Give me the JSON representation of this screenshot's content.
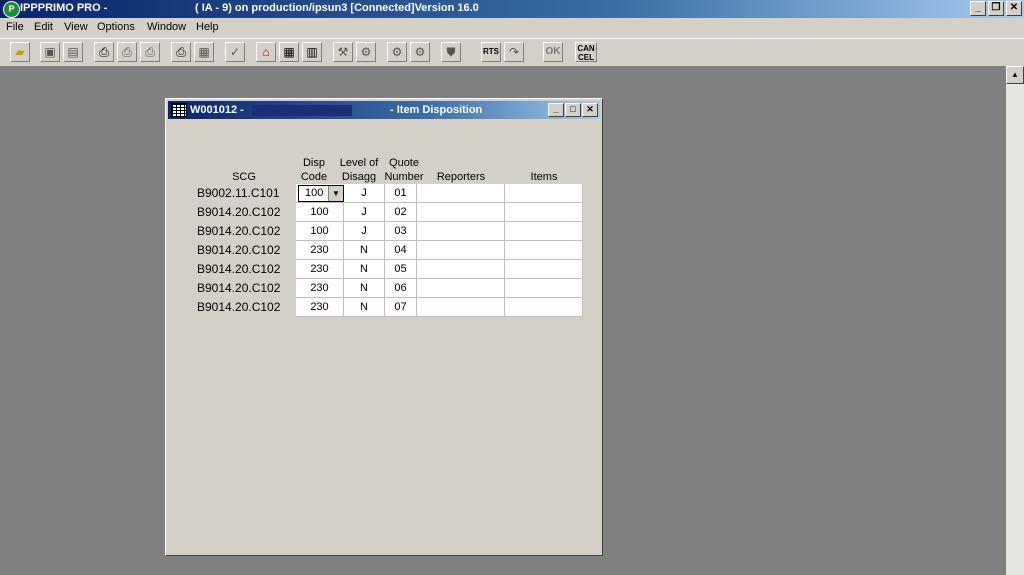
{
  "app": {
    "title": "IPPPRIMO PRO -",
    "subtitle": "( IA - 9) on production/ipsun3 [Connected]Version 16.0",
    "icon": "app-logo-icon"
  },
  "menu": [
    "File",
    "Edit",
    "View",
    "Options",
    "Window",
    "Help"
  ],
  "toolbar": {
    "buttons": [
      "open-folder-icon",
      "save-icon",
      "save-all-icon",
      "print-icon",
      "print-preview-icon",
      "print-setup-icon",
      "printer-icon",
      "print-report-icon",
      "check-icon",
      "home-icon",
      "grid-icon",
      "calendar-icon",
      "tool-a-icon",
      "tool-b-icon",
      "gear-a-icon",
      "gear-b-icon",
      "shield-icon"
    ],
    "rts_label": "RTS",
    "ok_label": "OK",
    "cancel_label": "CAN CEL"
  },
  "child_window": {
    "id": "W001012 -",
    "title": "- Item Disposition"
  },
  "table": {
    "headers": {
      "scg": "SCG",
      "disp": "Disp Code",
      "level": "Level of Disagg",
      "quote": "Quote Number",
      "reporters": "Reporters",
      "items": "Items"
    },
    "rows": [
      {
        "scg": "B9002.11.C101",
        "disp": "100",
        "level": "J",
        "quote": "01"
      },
      {
        "scg": "B9014.20.C102",
        "disp": "100",
        "level": "J",
        "quote": "02"
      },
      {
        "scg": "B9014.20.C102",
        "disp": "100",
        "level": "J",
        "quote": "03"
      },
      {
        "scg": "B9014.20.C102",
        "disp": "230",
        "level": "N",
        "quote": "04"
      },
      {
        "scg": "B9014.20.C102",
        "disp": "230",
        "level": "N",
        "quote": "05"
      },
      {
        "scg": "B9014.20.C102",
        "disp": "230",
        "level": "N",
        "quote": "06"
      },
      {
        "scg": "B9014.20.C102",
        "disp": "230",
        "level": "N",
        "quote": "07"
      }
    ]
  }
}
